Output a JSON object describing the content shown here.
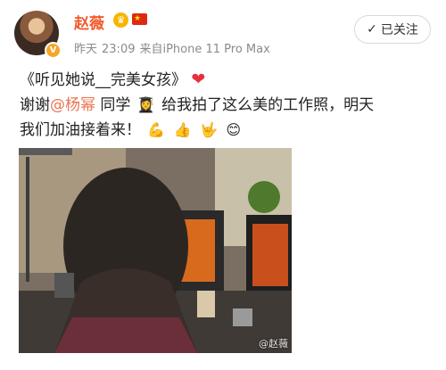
{
  "user": {
    "name": "赵薇",
    "verified_mark": "V"
  },
  "meta": {
    "time_prefix": "昨天",
    "time": "23:09",
    "source": "来自iPhone 11 Pro Max"
  },
  "follow_button": {
    "check": "✓",
    "label": "已关注"
  },
  "post": {
    "title_text": "《听见她说__完美女孩》",
    "heart": "❤",
    "thanks_prefix": "谢谢",
    "mention": "@杨幂",
    "thanks_mid": "同学",
    "emoji_student": "👩‍🎓",
    "line2_rest": "给我拍了这么美的工作照，明天",
    "line3_text": "我们加油接着来！",
    "emoji_muscle": "💪",
    "emoji_thumb": "👍",
    "emoji_love": "🤟",
    "emoji_smile": "😊"
  },
  "photo": {
    "watermark": "@赵薇"
  }
}
